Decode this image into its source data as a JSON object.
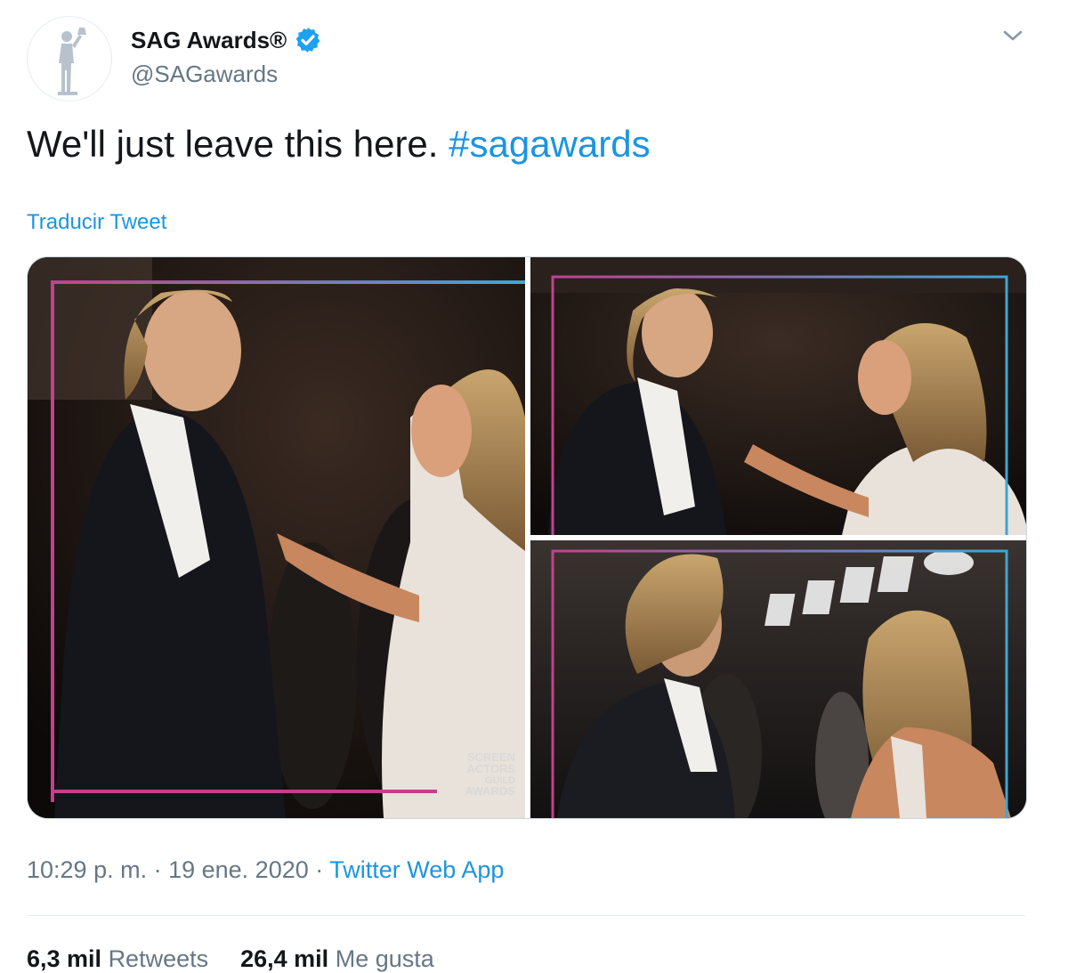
{
  "account": {
    "display_name": "SAG Awards®",
    "handle": "@SAGawards",
    "avatar_icon": "sag-actor-statue-logo",
    "verified_icon": "verified-badge-icon",
    "verified_color": "#1da1f2"
  },
  "tweet": {
    "text": "We'll just leave this here. ",
    "hashtag": "#sagawards",
    "translate_label": "Traducir Tweet"
  },
  "media": {
    "photos": [
      {
        "subject": "photo-1"
      },
      {
        "subject": "photo-2"
      },
      {
        "subject": "photo-3"
      }
    ],
    "watermark": [
      "SCREEN",
      "ACTORS",
      "GUILD",
      "AWARDS"
    ],
    "frame_colors": [
      "#c2418f",
      "#3fa5d6"
    ]
  },
  "meta": {
    "time": "10:29 p. m.",
    "sep1": " · ",
    "date": "19 ene. 2020",
    "sep2": " · ",
    "source": "Twitter Web App"
  },
  "stats": {
    "retweets_count": "6,3 mil",
    "retweets_label": "Retweets",
    "likes_count": "26,4 mil",
    "likes_label": "Me gusta"
  },
  "colors": {
    "link": "#1b95e0",
    "muted": "#657786",
    "text": "#14171a"
  }
}
